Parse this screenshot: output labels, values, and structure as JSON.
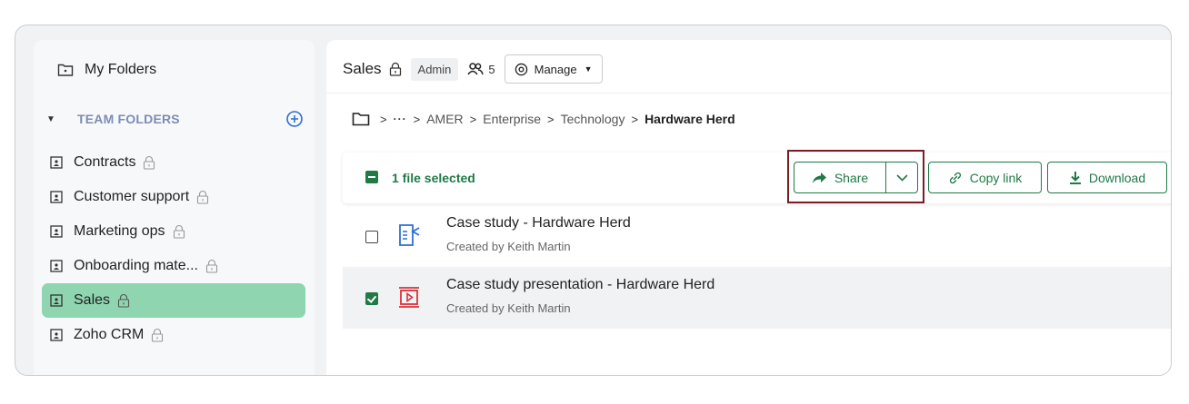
{
  "sidebar": {
    "my_folders": "My Folders",
    "team_folders_label": "TEAM FOLDERS",
    "folders": [
      {
        "label": "Contracts",
        "locked": true
      },
      {
        "label": "Customer support",
        "locked": true
      },
      {
        "label": "Marketing ops",
        "locked": true
      },
      {
        "label": "Onboarding mate...",
        "locked": true
      },
      {
        "label": "Sales",
        "locked": true,
        "active": true
      },
      {
        "label": "Zoho CRM",
        "locked": true
      }
    ]
  },
  "header": {
    "title": "Sales",
    "role_badge": "Admin",
    "member_count": "5",
    "manage_label": "Manage"
  },
  "breadcrumb": {
    "ellipsis": "···",
    "items": [
      "AMER",
      "Enterprise",
      "Technology"
    ],
    "current": "Hardware Herd"
  },
  "actionbar": {
    "selection_text": "1 file selected",
    "share_label": "Share",
    "copy_link_label": "Copy link",
    "download_label": "Download"
  },
  "files": [
    {
      "name": "Case study - Hardware Herd",
      "meta": "Created by Keith Martin",
      "checked": false,
      "icon": "document-icon"
    },
    {
      "name": "Case study presentation - Hardware Herd",
      "meta": "Created by Keith Martin",
      "checked": true,
      "icon": "presentation-icon"
    }
  ],
  "colors": {
    "accent_green": "#1f7a46",
    "active_folder": "#8ed5b0",
    "highlight_outline": "#7c1d23",
    "team_label": "#7b8db6",
    "doc_icon": "#2f6fd1",
    "presentation_icon": "#d8323a"
  }
}
